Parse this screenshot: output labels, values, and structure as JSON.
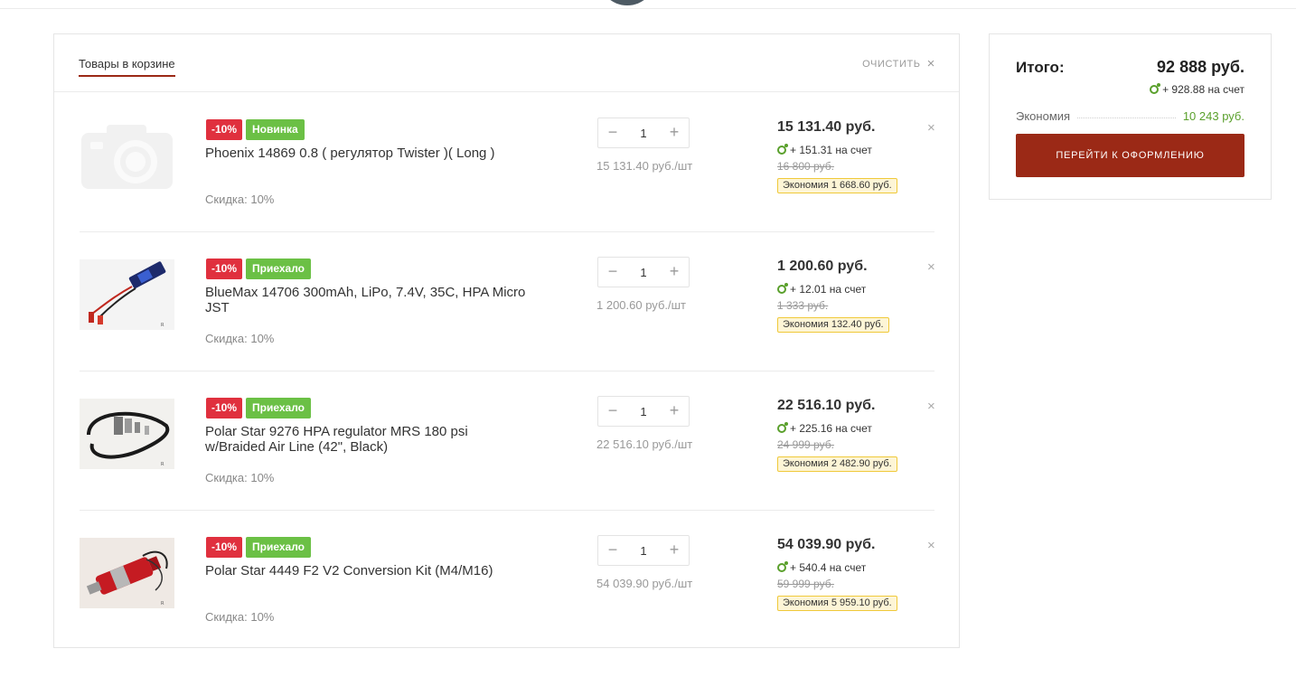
{
  "cart": {
    "tab_label": "Товары в корзине",
    "clear_label": "ОЧИСТИТЬ",
    "clear_icon": "×",
    "items": [
      {
        "thumb": "camera-placeholder",
        "discount_badge": "-10%",
        "status_badge": "Новинка",
        "name": "Phoenix 14869 0.8 ( регулятор Twister )( Long )",
        "sale_text": "Скидка: 10%",
        "qty_minus": "−",
        "quantity": "1",
        "qty_plus": "+",
        "unit_price": "15 131.40 руб./шт",
        "total": "15 131.40 руб.",
        "bonus": "+ 151.31 на счет",
        "old_price": "16 800 руб.",
        "economy": "Экономия  1 668.60 руб.",
        "remove": "×"
      },
      {
        "thumb": "battery",
        "discount_badge": "-10%",
        "status_badge": "Приехало",
        "name": "BlueMax 14706 300mAh, LiPo, 7.4V, 35C, HPA Micro JST",
        "sale_text": "Скидка: 10%",
        "qty_minus": "−",
        "quantity": "1",
        "qty_plus": "+",
        "unit_price": "1 200.60 руб./шт",
        "total": "1 200.60 руб.",
        "bonus": "+ 12.01 на счет",
        "old_price": "1 333 руб.",
        "economy": "Экономия  132.40 руб.",
        "remove": "×"
      },
      {
        "thumb": "hpa-line",
        "discount_badge": "-10%",
        "status_badge": "Приехало",
        "name": "Polar Star 9276 HPA regulator MRS 180 psi w/Braided Air Line (42\", Black)",
        "sale_text": "Скидка: 10%",
        "qty_minus": "−",
        "quantity": "1",
        "qty_plus": "+",
        "unit_price": "22 516.10 руб./шт",
        "total": "22 516.10 руб.",
        "bonus": "+ 225.16 на счет",
        "old_price": "24 999 руб.",
        "economy": "Экономия  2 482.90 руб.",
        "remove": "×"
      },
      {
        "thumb": "conversion-kit",
        "discount_badge": "-10%",
        "status_badge": "Приехало",
        "name": "Polar Star 4449 F2 V2 Conversion Kit (M4/M16)",
        "sale_text": "Скидка: 10%",
        "qty_minus": "−",
        "quantity": "1",
        "qty_plus": "+",
        "unit_price": "54 039.90 руб./шт",
        "total": "54 039.90 руб.",
        "bonus": "+ 540.4 на счет",
        "old_price": "59 999 руб.",
        "economy": "Экономия  5 959.10 руб.",
        "remove": "×"
      }
    ]
  },
  "summary": {
    "label": "Итого:",
    "total": "92 888 руб.",
    "bonus": "+ 928.88 на счет",
    "economy_label": "Экономия",
    "economy_value": "10 243 руб.",
    "checkout_label": "ПЕРЕЙТИ К ОФОРМЛЕНИЮ"
  },
  "colors": {
    "accent": "#9b2916",
    "discount": "#e0303e",
    "status": "#6bc045",
    "bonus": "#5aa02c",
    "economy_bg": "#fdf5d6",
    "economy_border": "#f0c93a"
  }
}
